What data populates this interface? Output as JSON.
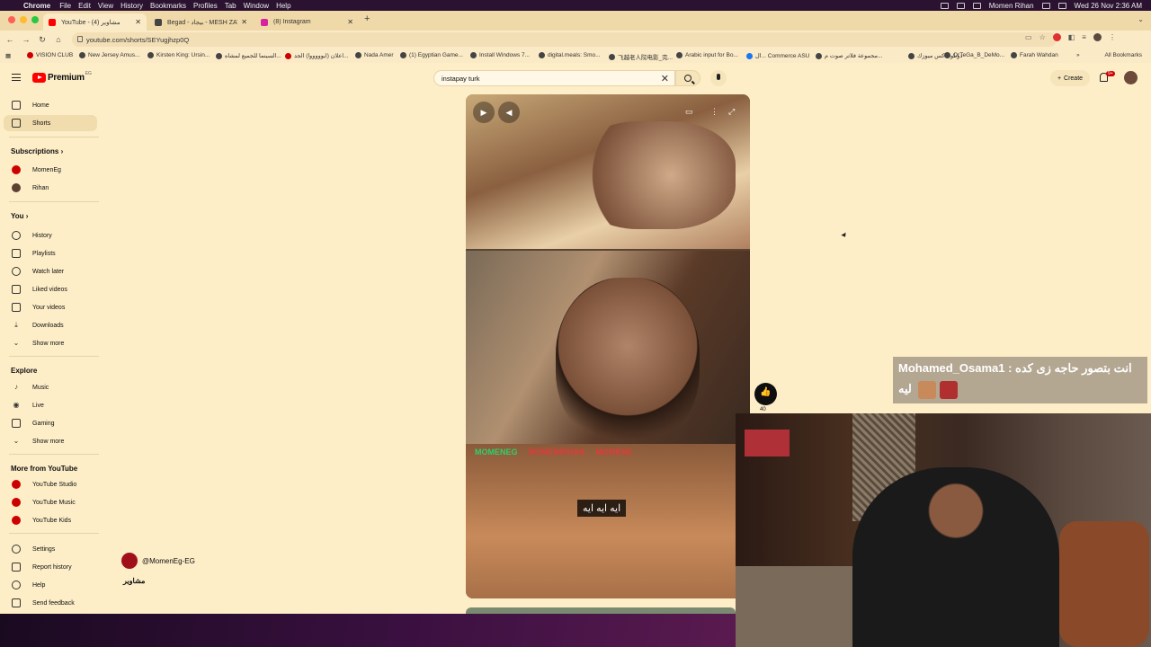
{
  "menubar": {
    "app": "Chrome",
    "items": [
      "File",
      "Edit",
      "View",
      "History",
      "Bookmarks",
      "Profiles",
      "Tab",
      "Window",
      "Help"
    ],
    "user": "Momen Rihan",
    "datetime": "Wed 26 Nov  2:36 AM"
  },
  "tabs": [
    {
      "title": "YouTube - مشاوير (4)",
      "active": true,
      "favicon_color": "#ff0000"
    },
    {
      "title": "Begad - بيجاد - MESH ZAY ZA",
      "active": false,
      "favicon_color": "#444444"
    },
    {
      "title": "(8) Instagram",
      "active": false,
      "favicon_color": "#d6249f"
    }
  ],
  "address": {
    "url": "youtube.com/shorts/SEYugjhzp0Q"
  },
  "bookmarks": [
    "VISION CLUB",
    "New Jersey Amus...",
    "Kirsten King: Ursin...",
    "السينما للجميع لمشاه...",
    "اعلان (ايوووووا) الجد...",
    "Nada Amer",
    "(1) Egyptian Game...",
    "Install Windows 7...",
    "digital.meals: Smo...",
    "飞越老人院电影_完...",
    "Arabic input for Bo...",
    "ال... Commerce ASU",
    "مجموعة فلاتر صوت م...",
    "دونلود اكس ميوزك",
    "OrTeGa_B_DeMo...",
    "Farah Wahdan"
  ],
  "all_bookmarks": "All Bookmarks",
  "youtube": {
    "logo_text": "Premium",
    "logo_region": "EG",
    "search_value": "instapay turk",
    "create_label": "Create",
    "notification_count": "9+",
    "sidebar": {
      "home": "Home",
      "shorts": "Shorts",
      "subscriptions": "Subscriptions",
      "subs": [
        "MomenEg",
        "Rihan"
      ],
      "you": "You",
      "you_items": [
        "History",
        "Playlists",
        "Watch later",
        "Liked videos",
        "Your videos",
        "Downloads",
        "Show more"
      ],
      "explore": "Explore",
      "explore_items": [
        "Music",
        "Live",
        "Gaming",
        "Show more"
      ],
      "more_from": "More from YouTube",
      "more_items": [
        "YouTube Studio",
        "YouTube Music",
        "YouTube Kids"
      ],
      "footer_items": [
        "Settings",
        "Report history",
        "Help",
        "Send feedback"
      ]
    },
    "short": {
      "watermarks": [
        "MOMENEG",
        "MOMENRIHAN",
        "MOMENE"
      ],
      "caption": "ايه ايه ايه",
      "channel": "@MomenEg-EG",
      "title": "مشاوير",
      "likes": "40"
    }
  },
  "stream": {
    "chat_line1": "Mohamed_Osama1 : انت بتصور حاجه زى كده",
    "chat_line2": "ليه"
  }
}
